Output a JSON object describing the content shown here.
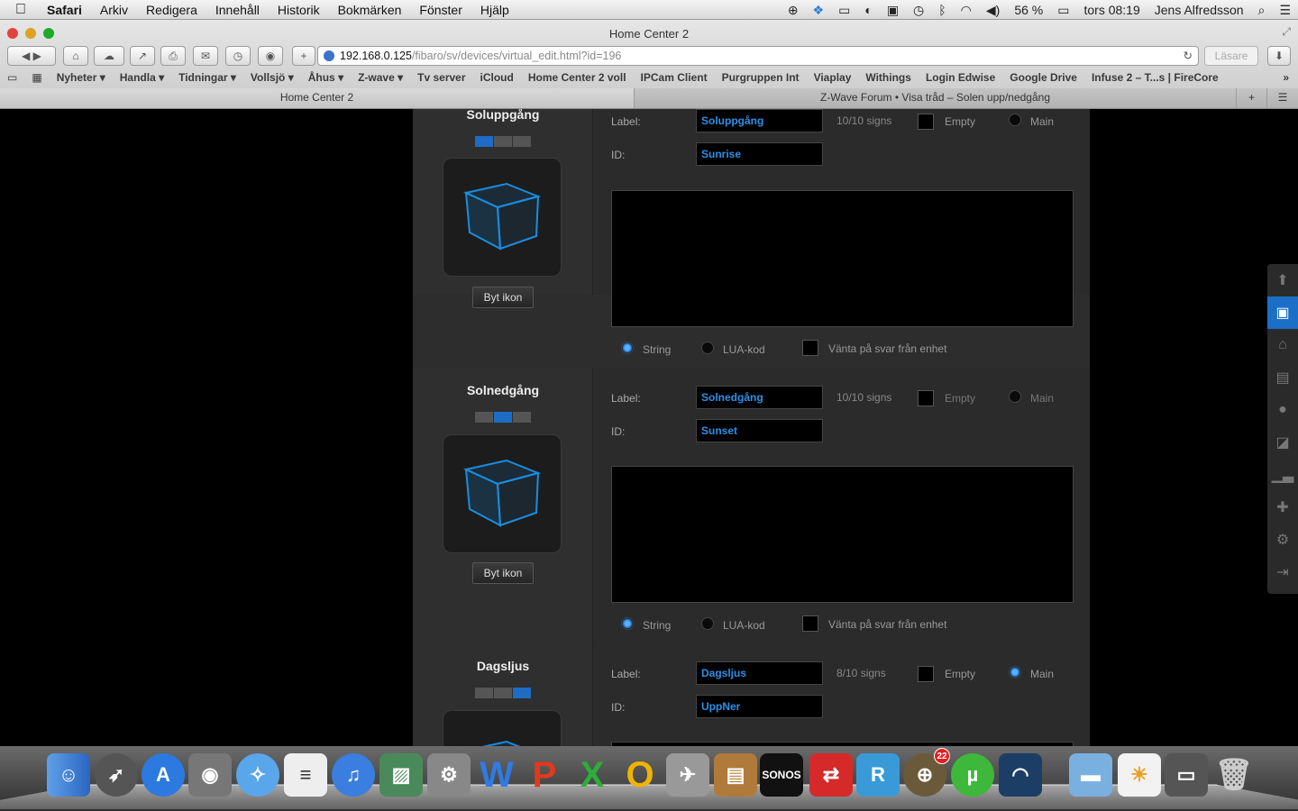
{
  "menubar": {
    "app": "Safari",
    "items": [
      "Arkiv",
      "Redigera",
      "Innehåll",
      "Historik",
      "Bokmärken",
      "Fönster",
      "Hjälp"
    ],
    "battery": "56 %",
    "clock": "tors 08:19",
    "user": "Jens Alfredsson"
  },
  "window": {
    "title": "Home Center 2"
  },
  "toolbar": {
    "url_host": "192.168.0.125",
    "url_path": "/fibaro/sv/devices/virtual_edit.html?id=196",
    "reader": "Läsare"
  },
  "bookmarks": [
    "Nyheter ▾",
    "Handla ▾",
    "Tidningar ▾",
    "Vollsjö ▾",
    "Åhus ▾",
    "Z-wave ▾",
    "Tv server",
    "iCloud",
    "Home Center 2 voll",
    "IPCam Client",
    "Purgruppen Int",
    "Viaplay",
    "Withings",
    "Login Edwise",
    "Google Drive",
    "Infuse 2 – T...s | FireCore"
  ],
  "tabs": {
    "active": "Home Center 2",
    "inactive": "Z-Wave Forum • Visa tråd – Solen upp/nedgång"
  },
  "devices": [
    {
      "name": "Soluppgång",
      "label_caption": "Label:",
      "label_value": "Soluppgång",
      "signs": "10/10 signs",
      "id_caption": "ID:",
      "id_value": "Sunrise",
      "empty": "Empty",
      "main": "Main",
      "string": "String",
      "lua": "LUA-kod",
      "wait": "Vänta på svar från enhet",
      "byt": "Byt ikon",
      "active_seg": 0,
      "main_selected": false
    },
    {
      "name": "Solnedgång",
      "label_caption": "Label:",
      "label_value": "Solnedgång",
      "signs": "10/10 signs",
      "id_caption": "ID:",
      "id_value": "Sunset",
      "empty": "Empty",
      "main": "Main",
      "string": "String",
      "lua": "LUA-kod",
      "wait": "Vänta på svar från enhet",
      "byt": "Byt ikon",
      "active_seg": 1,
      "main_selected": false
    },
    {
      "name": "Dagsljus",
      "label_caption": "Label:",
      "label_value": "Dagsljus",
      "signs": "8/10 signs",
      "id_caption": "ID:",
      "id_value": "UppNer",
      "empty": "Empty",
      "main": "Main",
      "active_seg": 2,
      "main_selected": true
    }
  ],
  "sidebar": {
    "icons": [
      "arrow-up-icon",
      "save-icon",
      "home-icon",
      "rooms-icon",
      "light-icon",
      "scenes-icon",
      "chart-icon",
      "plugin-icon",
      "settings-icon",
      "logout-icon"
    ],
    "active": "save-icon"
  },
  "dock": {
    "apps": [
      "finder-icon",
      "launchpad-icon",
      "app-store-icon",
      "facetime-icon",
      "safari-icon",
      "textedit-icon",
      "itunes-icon",
      "iphoto-icon",
      "system-preferences-icon",
      "word-icon",
      "powerpoint-icon",
      "excel-icon",
      "outlook-icon",
      "network-icon",
      "cleaner-icon",
      "sonos-icon",
      "remote-desktop-icon",
      "royal-tsx-icon",
      "scope-icon",
      "utorrent-icon",
      "wifi-scanner-icon",
      "downloads-folder-icon",
      "weather-icon",
      "devices-icon",
      "trash-icon"
    ],
    "sonos_text": "SONOS",
    "badge": "22"
  }
}
